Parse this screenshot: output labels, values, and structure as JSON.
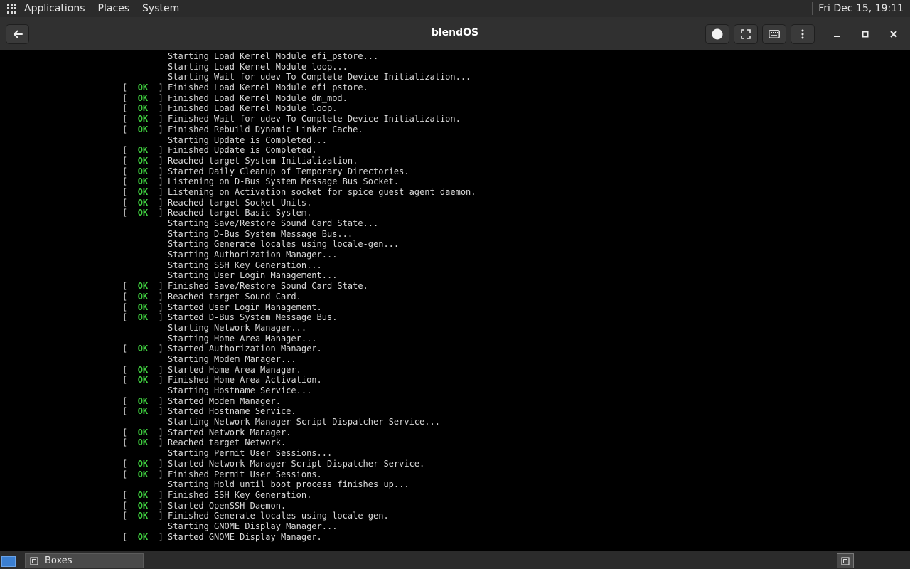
{
  "top_panel": {
    "menus": [
      "Applications",
      "Places",
      "System"
    ],
    "clock": "Fri Dec 15, 19:11"
  },
  "header": {
    "title": "blendOS",
    "icons": {
      "back": "arrow-left-icon",
      "record": "record-circle-icon",
      "fullscreen": "fullscreen-icon",
      "keyboard": "keyboard-icon",
      "menu": "vertical-dots-icon",
      "minimize": "minimize-icon",
      "maximize": "maximize-icon",
      "close": "close-icon"
    }
  },
  "console": {
    "ok_label": "OK",
    "ok_color": "#3fce3f",
    "lines": [
      {
        "status": "",
        "verb": "Starting",
        "text": "Load Kernel Module efi_pstore..."
      },
      {
        "status": "",
        "verb": "Starting",
        "text": "Load Kernel Module loop..."
      },
      {
        "status": "",
        "verb": "Starting",
        "text": "Wait for udev To Complete Device Initialization..."
      },
      {
        "status": "OK",
        "verb": "Finished",
        "text": "Load Kernel Module efi_pstore."
      },
      {
        "status": "OK",
        "verb": "Finished",
        "text": "Load Kernel Module dm_mod."
      },
      {
        "status": "OK",
        "verb": "Finished",
        "text": "Load Kernel Module loop."
      },
      {
        "status": "OK",
        "verb": "Finished",
        "text": "Wait for udev To Complete Device Initialization."
      },
      {
        "status": "OK",
        "verb": "Finished",
        "text": "Rebuild Dynamic Linker Cache."
      },
      {
        "status": "",
        "verb": "Starting",
        "text": "Update is Completed..."
      },
      {
        "status": "OK",
        "verb": "Finished",
        "text": "Update is Completed."
      },
      {
        "status": "OK",
        "verb": "Reached target",
        "text": "System Initialization."
      },
      {
        "status": "OK",
        "verb": "Started",
        "text": "Daily Cleanup of Temporary Directories."
      },
      {
        "status": "OK",
        "verb": "Listening on",
        "text": "D-Bus System Message Bus Socket."
      },
      {
        "status": "OK",
        "verb": "Listening on",
        "text": "Activation socket for spice guest agent daemon."
      },
      {
        "status": "OK",
        "verb": "Reached target",
        "text": "Socket Units."
      },
      {
        "status": "OK",
        "verb": "Reached target",
        "text": "Basic System."
      },
      {
        "status": "",
        "verb": "Starting",
        "text": "Save/Restore Sound Card State..."
      },
      {
        "status": "",
        "verb": "Starting",
        "text": "D-Bus System Message Bus..."
      },
      {
        "status": "",
        "verb": "Starting",
        "text": "Generate locales using locale-gen..."
      },
      {
        "status": "",
        "verb": "Starting",
        "text": "Authorization Manager..."
      },
      {
        "status": "",
        "verb": "Starting",
        "text": "SSH Key Generation..."
      },
      {
        "status": "",
        "verb": "Starting",
        "text": "User Login Management..."
      },
      {
        "status": "OK",
        "verb": "Finished",
        "text": "Save/Restore Sound Card State."
      },
      {
        "status": "OK",
        "verb": "Reached target",
        "text": "Sound Card."
      },
      {
        "status": "OK",
        "verb": "Started",
        "text": "User Login Management."
      },
      {
        "status": "OK",
        "verb": "Started",
        "text": "D-Bus System Message Bus."
      },
      {
        "status": "",
        "verb": "Starting",
        "text": "Network Manager..."
      },
      {
        "status": "",
        "verb": "Starting",
        "text": "Home Area Manager..."
      },
      {
        "status": "OK",
        "verb": "Started",
        "text": "Authorization Manager."
      },
      {
        "status": "",
        "verb": "Starting",
        "text": "Modem Manager..."
      },
      {
        "status": "OK",
        "verb": "Started",
        "text": "Home Area Manager."
      },
      {
        "status": "OK",
        "verb": "Finished",
        "text": "Home Area Activation."
      },
      {
        "status": "",
        "verb": "Starting",
        "text": "Hostname Service..."
      },
      {
        "status": "OK",
        "verb": "Started",
        "text": "Modem Manager."
      },
      {
        "status": "OK",
        "verb": "Started",
        "text": "Hostname Service."
      },
      {
        "status": "",
        "verb": "Starting",
        "text": "Network Manager Script Dispatcher Service..."
      },
      {
        "status": "OK",
        "verb": "Started",
        "text": "Network Manager."
      },
      {
        "status": "OK",
        "verb": "Reached target",
        "text": "Network."
      },
      {
        "status": "",
        "verb": "Starting",
        "text": "Permit User Sessions..."
      },
      {
        "status": "OK",
        "verb": "Started",
        "text": "Network Manager Script Dispatcher Service."
      },
      {
        "status": "OK",
        "verb": "Finished",
        "text": "Permit User Sessions."
      },
      {
        "status": "",
        "verb": "Starting",
        "text": "Hold until boot process finishes up..."
      },
      {
        "status": "OK",
        "verb": "Finished",
        "text": "SSH Key Generation."
      },
      {
        "status": "OK",
        "verb": "Started",
        "text": "OpenSSH Daemon."
      },
      {
        "status": "OK",
        "verb": "Finished",
        "text": "Generate locales using locale-gen."
      },
      {
        "status": "",
        "verb": "Starting",
        "text": "GNOME Display Manager..."
      },
      {
        "status": "OK",
        "verb": "Started",
        "text": "GNOME Display Manager."
      }
    ]
  },
  "taskbar": {
    "tasks": [
      {
        "label": "Boxes",
        "icon": "boxes-app-icon"
      }
    ],
    "show_desktop_icon": "show-desktop-icon",
    "workspace_icon": "workspace-switcher-icon"
  }
}
